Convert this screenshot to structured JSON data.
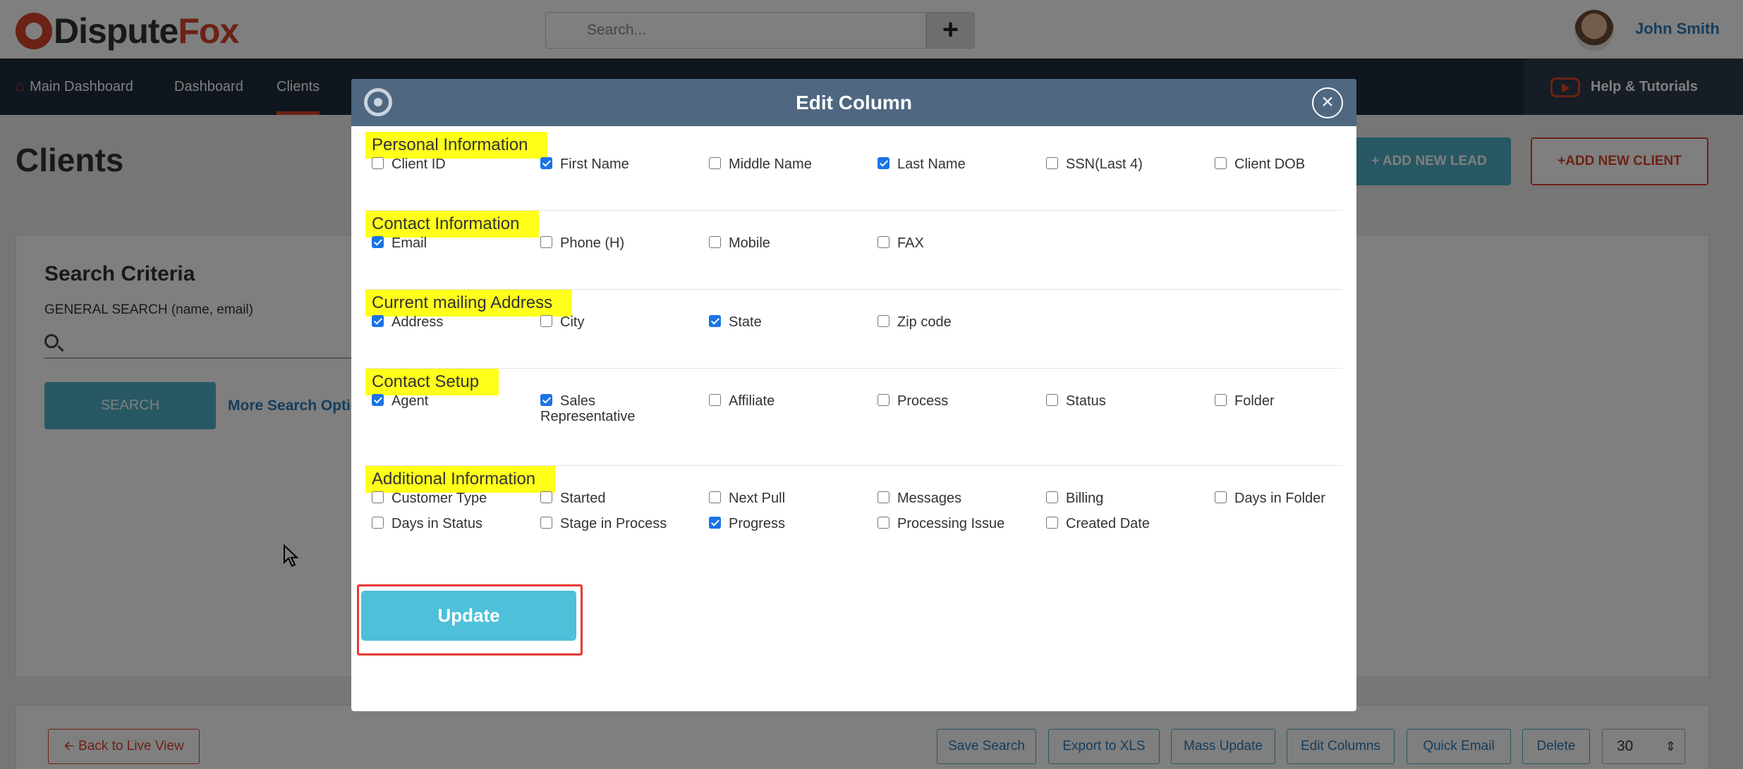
{
  "app": {
    "logo_part1": "Dispute",
    "logo_part2": "Fox",
    "search_placeholder": "Search...",
    "plus_label": "+",
    "user_name": "John Smith"
  },
  "nav": {
    "items": [
      "Main Dashboard",
      "Dashboard",
      "Clients"
    ],
    "active": "Clients",
    "help_label": "Help & Tutorials"
  },
  "page": {
    "title": "Clients",
    "add_lead_label": "+ ADD NEW LEAD",
    "add_client_label": "+ADD NEW CLIENT"
  },
  "criteria": {
    "title": "Search Criteria",
    "general_label": "GENERAL SEARCH (name, email)",
    "search_button": "SEARCH",
    "more_link": "More Search Option"
  },
  "bottom": {
    "back_label": "Back to Live View",
    "buttons": [
      "Save Search",
      "Export to XLS",
      "Mass Update",
      "Edit Columns",
      "Quick Email",
      "Delete"
    ],
    "page_size": "30"
  },
  "modal": {
    "title": "Edit Column",
    "update_label": "Update",
    "sections": [
      {
        "title": "Personal Information",
        "options": [
          {
            "label": "Client ID",
            "checked": false
          },
          {
            "label": "First Name",
            "checked": true
          },
          {
            "label": "Middle Name",
            "checked": false
          },
          {
            "label": "Last Name",
            "checked": true
          },
          {
            "label": "SSN(Last 4)",
            "checked": false
          },
          {
            "label": "Client DOB",
            "checked": false
          }
        ]
      },
      {
        "title": "Contact Information",
        "options": [
          {
            "label": "Email",
            "checked": true
          },
          {
            "label": "Phone (H)",
            "checked": false
          },
          {
            "label": "Mobile",
            "checked": false
          },
          {
            "label": "FAX",
            "checked": false
          }
        ]
      },
      {
        "title": "Current mailing Address",
        "options": [
          {
            "label": "Address",
            "checked": true
          },
          {
            "label": "City",
            "checked": false
          },
          {
            "label": "State",
            "checked": true
          },
          {
            "label": "Zip code",
            "checked": false
          }
        ]
      },
      {
        "title": "Contact Setup",
        "options": [
          {
            "label": "Agent",
            "checked": true
          },
          {
            "label": "Sales Representative",
            "checked": true
          },
          {
            "label": "Affiliate",
            "checked": false
          },
          {
            "label": "Process",
            "checked": false
          },
          {
            "label": "Status",
            "checked": false
          },
          {
            "label": "Folder",
            "checked": false
          }
        ]
      },
      {
        "title": "Additional Information",
        "options": [
          {
            "label": "Customer Type",
            "checked": false
          },
          {
            "label": "Started",
            "checked": false
          },
          {
            "label": "Next Pull",
            "checked": false
          },
          {
            "label": "Messages",
            "checked": false
          },
          {
            "label": "Billing",
            "checked": false
          },
          {
            "label": "Days in Folder",
            "checked": false
          },
          {
            "label": "Days in Status",
            "checked": false
          },
          {
            "label": "Stage in Process",
            "checked": false
          },
          {
            "label": "Progress",
            "checked": true
          },
          {
            "label": "Processing Issue",
            "checked": false
          },
          {
            "label": "Created Date",
            "checked": false
          }
        ]
      }
    ]
  }
}
